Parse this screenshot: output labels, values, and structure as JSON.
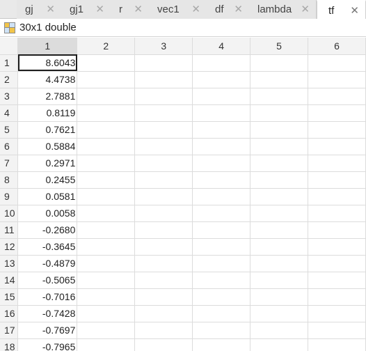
{
  "tabs": [
    {
      "label": "gj",
      "active": false
    },
    {
      "label": "gj1",
      "active": false
    },
    {
      "label": "r",
      "active": false
    },
    {
      "label": "vec1",
      "active": false
    },
    {
      "label": "df",
      "active": false
    },
    {
      "label": "lambda",
      "active": false
    },
    {
      "label": "tf",
      "active": true
    }
  ],
  "close_glyph": "✕",
  "infobar": {
    "icon": "variable-matrix-icon",
    "size_label": "30x1 double"
  },
  "columns": [
    "1",
    "2",
    "3",
    "4",
    "5",
    "6"
  ],
  "rows": [
    {
      "index": "1",
      "value": "8.6043"
    },
    {
      "index": "2",
      "value": "4.4738"
    },
    {
      "index": "3",
      "value": "2.7881"
    },
    {
      "index": "4",
      "value": "0.8119"
    },
    {
      "index": "5",
      "value": "0.7621"
    },
    {
      "index": "6",
      "value": "0.5884"
    },
    {
      "index": "7",
      "value": "0.2971"
    },
    {
      "index": "8",
      "value": "0.2455"
    },
    {
      "index": "9",
      "value": "0.0581"
    },
    {
      "index": "10",
      "value": "0.0058"
    },
    {
      "index": "11",
      "value": "-0.2680"
    },
    {
      "index": "12",
      "value": "-0.3645"
    },
    {
      "index": "13",
      "value": "-0.4879"
    },
    {
      "index": "14",
      "value": "-0.5065"
    },
    {
      "index": "15",
      "value": "-0.7016"
    },
    {
      "index": "16",
      "value": "-0.7428"
    },
    {
      "index": "17",
      "value": "-0.7697"
    },
    {
      "index": "18",
      "value": "-0.7965"
    }
  ],
  "selected_column": "1",
  "selected_row": "1"
}
